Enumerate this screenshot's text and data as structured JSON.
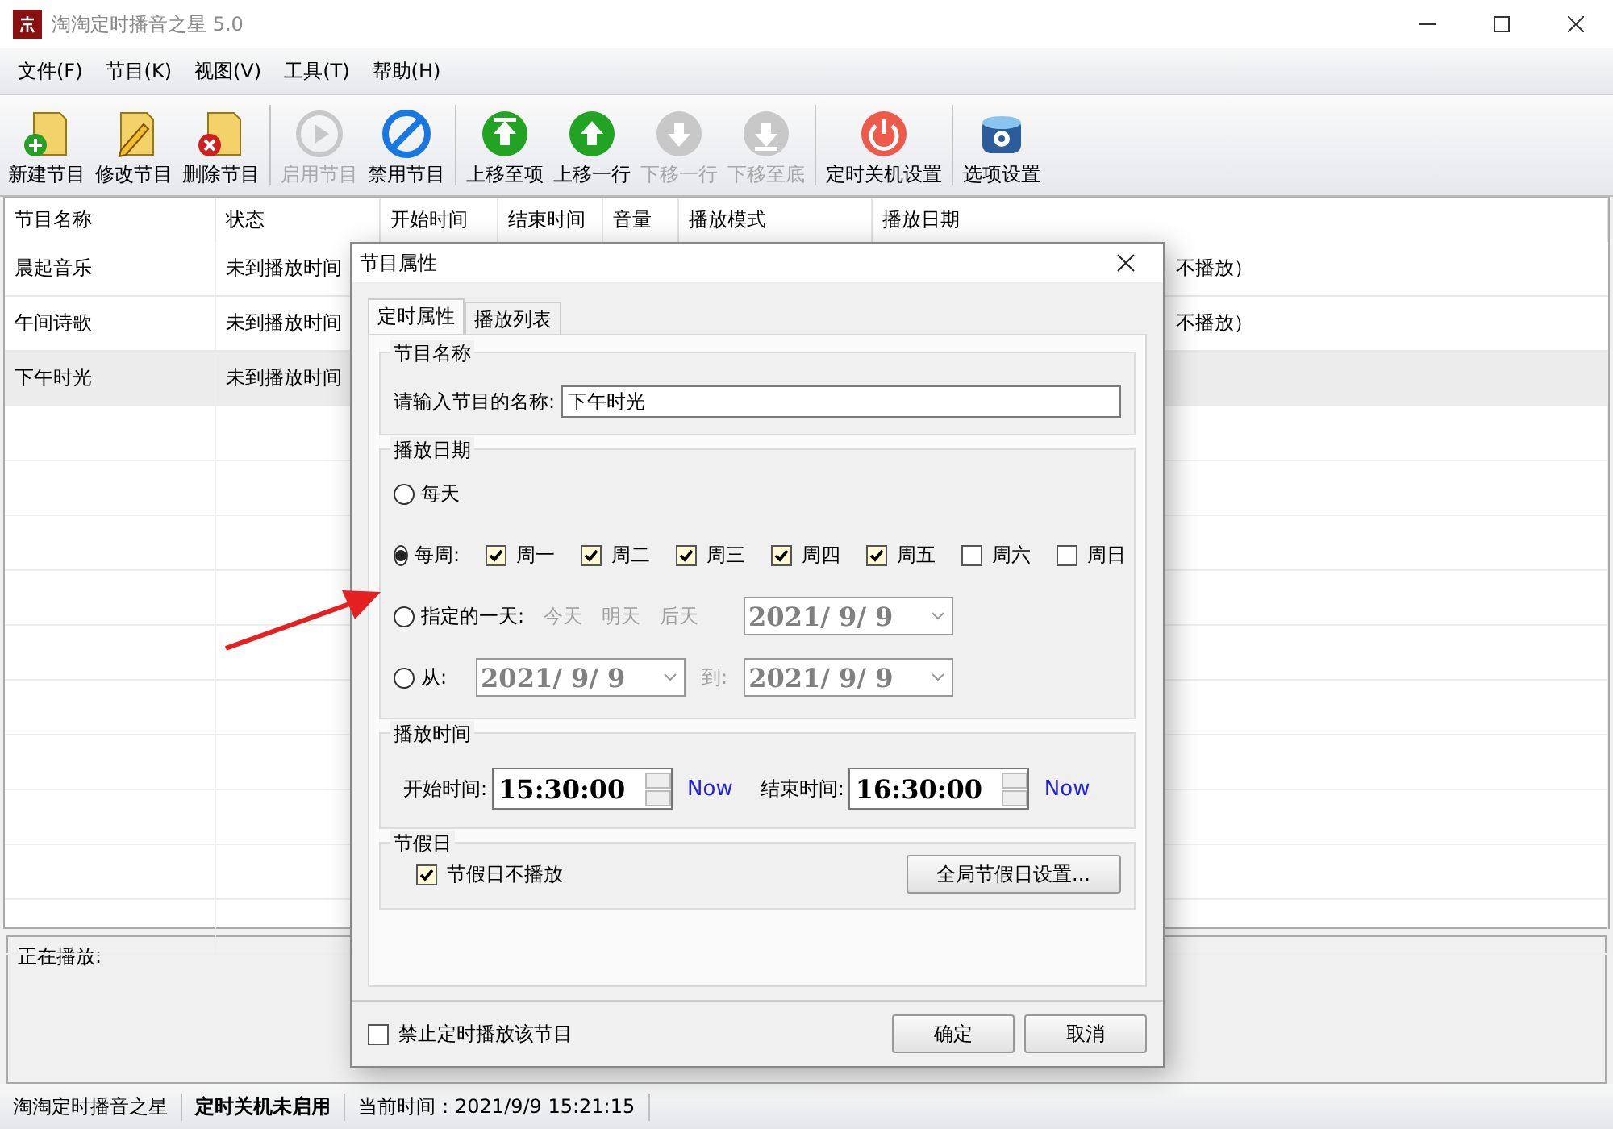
{
  "window": {
    "title": "淘淘定时播音之星 5.0"
  },
  "menu": [
    "文件(F)",
    "节目(K)",
    "视图(V)",
    "工具(T)",
    "帮助(H)"
  ],
  "toolbar": [
    [
      {
        "kind": "new",
        "label": "新建节目",
        "disabled": false
      },
      {
        "kind": "edit",
        "label": "修改节目",
        "disabled": false
      },
      {
        "kind": "delete",
        "label": "删除节目",
        "disabled": false
      }
    ],
    [
      {
        "kind": "enable",
        "label": "启用节目",
        "disabled": true
      },
      {
        "kind": "disable",
        "label": "禁用节目",
        "disabled": false
      }
    ],
    [
      {
        "kind": "top",
        "label": "上移至项",
        "disabled": false
      },
      {
        "kind": "up",
        "label": "上移一行",
        "disabled": false
      },
      {
        "kind": "down",
        "label": "下移一行",
        "disabled": true
      },
      {
        "kind": "bottom",
        "label": "下移至底",
        "disabled": true
      }
    ],
    [
      {
        "kind": "power",
        "label": "定时关机设置",
        "disabled": false
      }
    ],
    [
      {
        "kind": "options",
        "label": "选项设置",
        "disabled": false
      }
    ]
  ],
  "table": {
    "columns": [
      "节目名称",
      "状态",
      "开始时间",
      "结束时间",
      "音量",
      "播放模式",
      "播放日期"
    ],
    "rows": [
      {
        "name": "晨起音乐",
        "status": "未到播放时间",
        "date_tail": "不播放）",
        "selected": false
      },
      {
        "name": "午间诗歌",
        "status": "未到播放时间",
        "date_tail": "不播放）",
        "selected": false
      },
      {
        "name": "下午时光",
        "status": "未到播放时间",
        "selected": true
      }
    ]
  },
  "now_playing": {
    "label": "正在播放:"
  },
  "status_bar": [
    {
      "text": "淘淘定时播音之星",
      "bold": false
    },
    {
      "text": "定时关机未启用",
      "bold": true
    },
    {
      "text": "当前时间：2021/9/9 15:21:15",
      "bold": false
    }
  ],
  "dialog": {
    "title": "节目属性",
    "tabs": [
      {
        "label": "定时属性",
        "selected": true
      },
      {
        "label": "播放列表",
        "selected": false
      }
    ],
    "name_group": {
      "title": "节目名称",
      "label": "请输入节目的名称:",
      "value": "下午时光"
    },
    "date_group": {
      "title": "播放日期",
      "options": [
        {
          "kind": "daily",
          "label": "每天",
          "selected": false
        },
        {
          "kind": "weekly",
          "label": "每周:",
          "selected": true,
          "days": [
            {
              "label": "周一",
              "checked": true
            },
            {
              "label": "周二",
              "checked": true
            },
            {
              "label": "周三",
              "checked": true
            },
            {
              "label": "周四",
              "checked": true
            },
            {
              "label": "周五",
              "checked": true
            },
            {
              "label": "周六",
              "checked": false
            },
            {
              "label": "周日",
              "checked": false
            }
          ]
        },
        {
          "kind": "specific",
          "label": "指定的一天:",
          "selected": false,
          "quick": [
            "今天",
            "明天",
            "后天"
          ],
          "date": "2021/  9/  9"
        },
        {
          "kind": "range",
          "label": "从:",
          "selected": false,
          "from": "2021/  9/  9",
          "to_label": "到:",
          "to": "2021/  9/  9"
        }
      ]
    },
    "time_group": {
      "title": "播放时间",
      "start_label": "开始时间:",
      "start": "15:30:00",
      "start_now": "Now",
      "end_label": "结束时间:",
      "end": "16:30:00",
      "end_now": "Now"
    },
    "holiday_group": {
      "title": "节假日",
      "checkbox": {
        "label": "节假日不播放",
        "checked": true
      },
      "button": "全局节假日设置..."
    },
    "footer": {
      "checkbox": {
        "label": "禁止定时播放该节目",
        "checked": false
      },
      "buttons": [
        "确定",
        "取消"
      ]
    }
  }
}
